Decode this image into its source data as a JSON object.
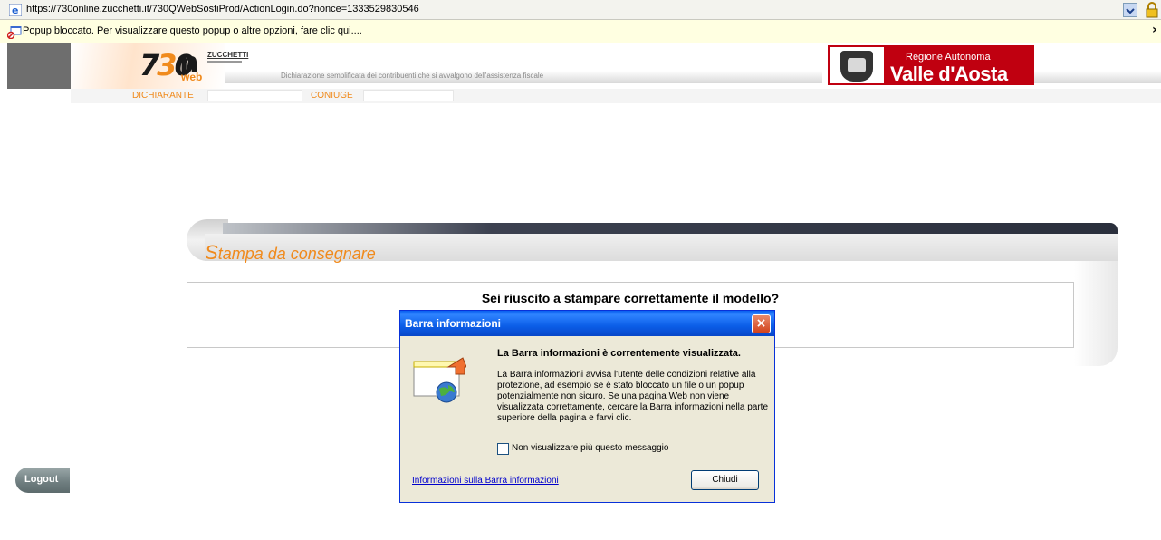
{
  "browser": {
    "url": "https://730online.zucchetti.it/730QWebSostiProd/ActionLogin.do?nonce=1333529830546",
    "info_bar_text": "Popup bloccato. Per visualizzare questo popup o altre opzioni, fare clic qui....",
    "info_bar_close": "›"
  },
  "header": {
    "logo_prefix": "7",
    "logo_three": "3",
    "logo_zero": "0",
    "logo_on": "n",
    "logo_web": "web",
    "zucchetti": "ZUCCHETTI",
    "tagline": "Dichiarazione semplificata dei contribuenti che si avvalgono dell'assistenza fiscale",
    "regione_top": "Regione Autonoma",
    "regione_main": "Valle d'Aosta"
  },
  "tabs": {
    "dichiarante": "DICHIARANTE",
    "coniuge": "CONIUGE"
  },
  "section": {
    "title_first": "S",
    "title_rest": "tampa da consegnare",
    "question": "Sei riuscito a stampare correttamente il modello?"
  },
  "sidebar": {
    "logout": "Logout"
  },
  "dialog": {
    "title": "Barra informazioni",
    "close_glyph": "×",
    "heading": "La Barra informazioni è correntemente visualizzata.",
    "description": "La Barra informazioni avvisa l'utente delle condizioni relative alla protezione, ad esempio se è stato bloccato un file o un popup potenzialmente non sicuro. Se una pagina Web non viene visualizzata correttamente, cercare la Barra informazioni nella parte superiore della pagina e farvi clic.",
    "checkbox_label": "Non visualizzare più questo messaggio",
    "checkbox_checked": false,
    "link": "Informazioni sulla Barra informazioni",
    "button": "Chiudi"
  },
  "colors": {
    "accent_orange": "#f08a1c",
    "regione_red": "#c00010",
    "dialog_titlebar": "#0a5ee8"
  }
}
